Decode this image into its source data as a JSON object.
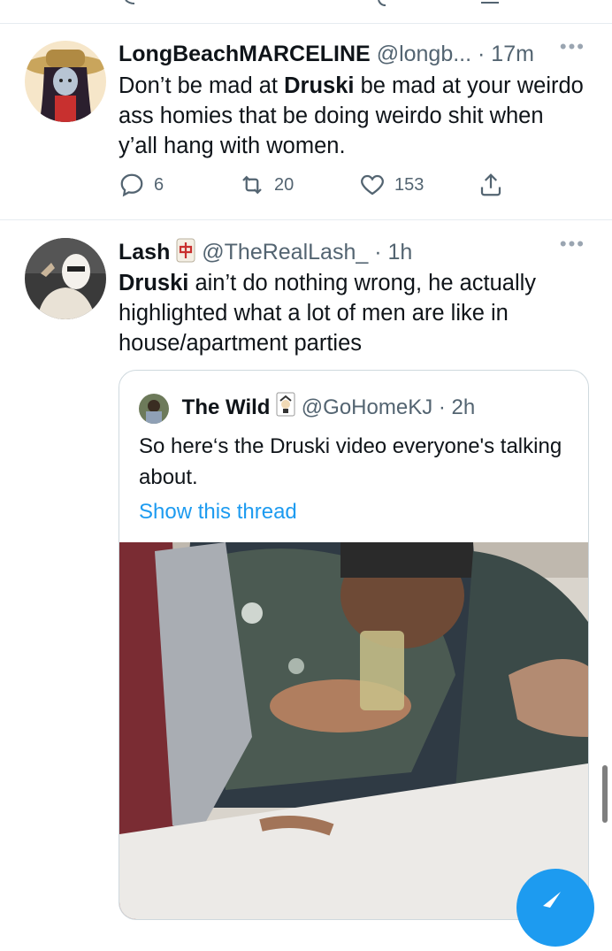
{
  "tweet1": {
    "name": "LongBeachMARCELINE",
    "handle": "@longb...",
    "time": "· 17m",
    "text_before": "Don’t be mad at ",
    "text_bold": "Druski",
    "text_after": " be mad at your weirdo ass homies that be doing weirdo shit when y’all hang with women.",
    "replies": "6",
    "retweets": "20",
    "likes": "153",
    "more": "•••"
  },
  "tweet2": {
    "name": "Lash",
    "name_emoji": "🀄",
    "handle": "@TheRealLash_",
    "time": "· 1h",
    "text_bold": "Druski",
    "text_after": " ain’t do nothing wrong, he actually highlighted what a lot of men are like in house/apartment parties",
    "more": "•••"
  },
  "quote": {
    "name": "The Wild",
    "name_emoji": "🃏",
    "handle": "@GoHomeKJ",
    "time": "· 2h",
    "text": "So here‘s the Druski video everyone's talking about.",
    "link": "Show this thread"
  },
  "colors": {
    "accent": "#1d9bf0",
    "secondary_text": "#536471",
    "divider": "#e6ecf0"
  },
  "icons": [
    "reply-icon",
    "retweet-icon",
    "like-icon",
    "share-icon",
    "compose-icon"
  ]
}
